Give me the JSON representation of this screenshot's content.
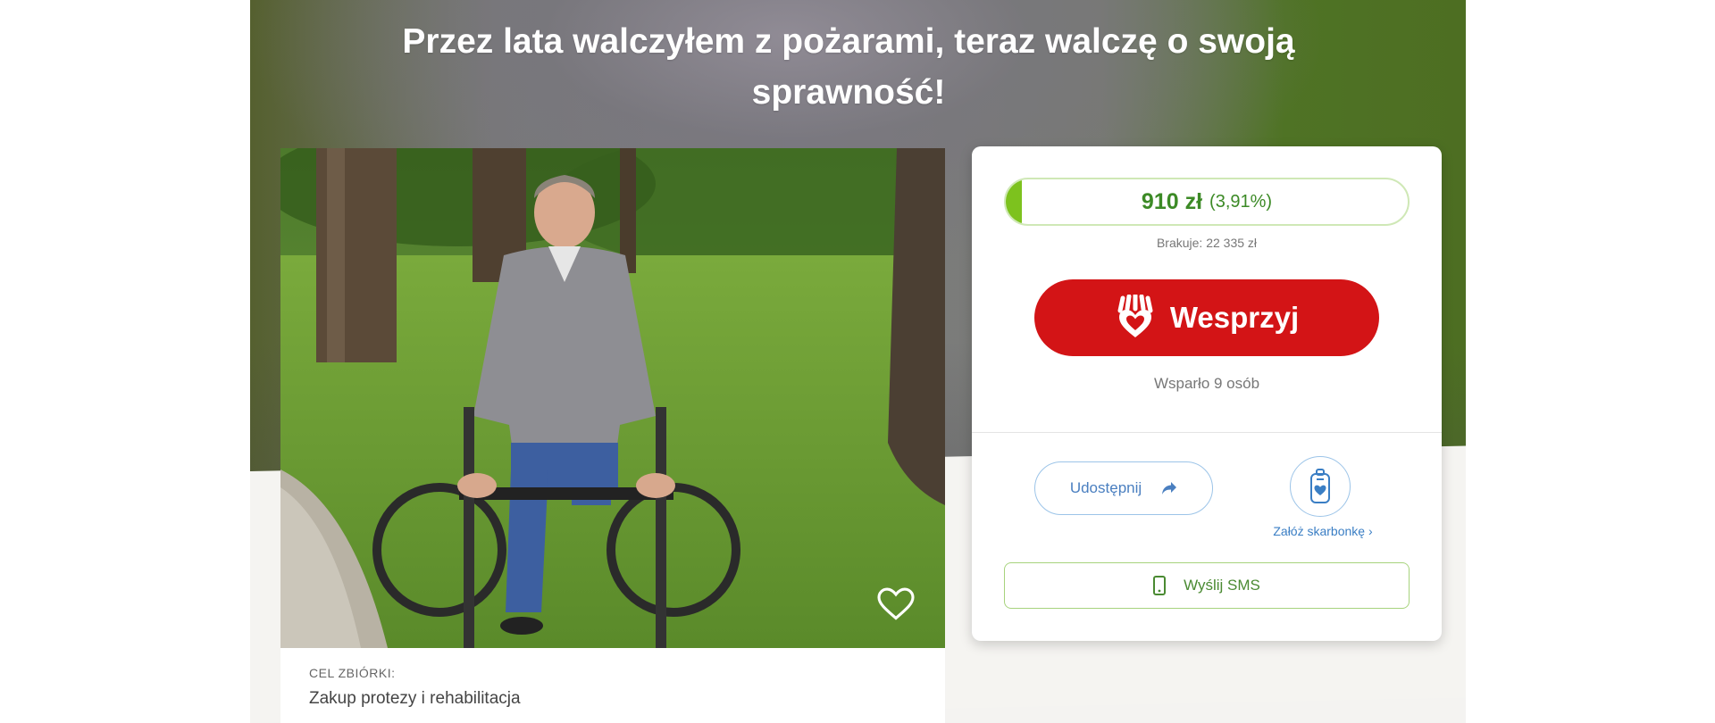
{
  "page": {
    "title": "Przez lata walczyłem z pożarami, teraz walczę o swoją sprawność!"
  },
  "photo": {
    "favorite_icon": "heart-outline-icon",
    "alt": "Zdjęcie beneficjenta"
  },
  "goal": {
    "label": "CEL ZBIÓRKI:",
    "value": "Zakup protezy i rehabilitacja"
  },
  "donation": {
    "amount": "910 zł",
    "percent": "(3,91%)",
    "progress_fraction": 0.0391,
    "missing": "Brakuje: 22 335 zł",
    "support_label": "Wesprzyj",
    "support_icon": "heart-hand-icon",
    "supporters": "Wsparło 9 osób"
  },
  "actions": {
    "share_label": "Udostępnij",
    "share_icon": "share-arrow-icon",
    "piggy_icon": "piggy-bank-icon",
    "piggy_label": "Załóż skarbonkę ›",
    "sms_label": "Wyślij SMS",
    "sms_icon": "phone-icon"
  },
  "colors": {
    "support_button": "#d31416",
    "progress_fill": "#7dc21e",
    "amount_text": "#3c8a26",
    "link_blue": "#3a7ec4"
  }
}
